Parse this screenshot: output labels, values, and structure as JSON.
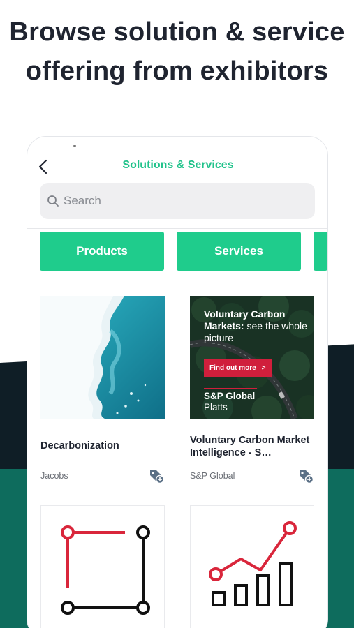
{
  "headline": "Browse solution & service offering from exhibitors",
  "app": {
    "title": "Solutions & Services",
    "search": {
      "placeholder": "Search",
      "value": ""
    },
    "tabs": [
      {
        "label": "Products"
      },
      {
        "label": "Services"
      },
      {
        "label": ""
      }
    ],
    "cards": [
      {
        "title": "Decarbonization",
        "company": "Jacobs",
        "image": "ice-shelf-aerial-photo"
      },
      {
        "title": "Voluntary Carbon Market Intelligence - S…",
        "company": "S&P Global",
        "image": "forest-road-ad",
        "ad": {
          "headline_bold": "Voluntary Carbon Markets:",
          "headline_rest": " see the whole picture",
          "cta": "Find out more",
          "cta_arrow": ">",
          "brand_line1": "S&P Global",
          "brand_line2": "Platts"
        }
      },
      {
        "image": "square-frame-icon"
      },
      {
        "image": "growth-chart-icon"
      }
    ]
  },
  "colors": {
    "accent": "#1fcc8c",
    "title": "#1fc28a",
    "dark_band": "#0f1e26",
    "teal_band": "#0e6c5d",
    "icon_red": "#d9263b"
  }
}
